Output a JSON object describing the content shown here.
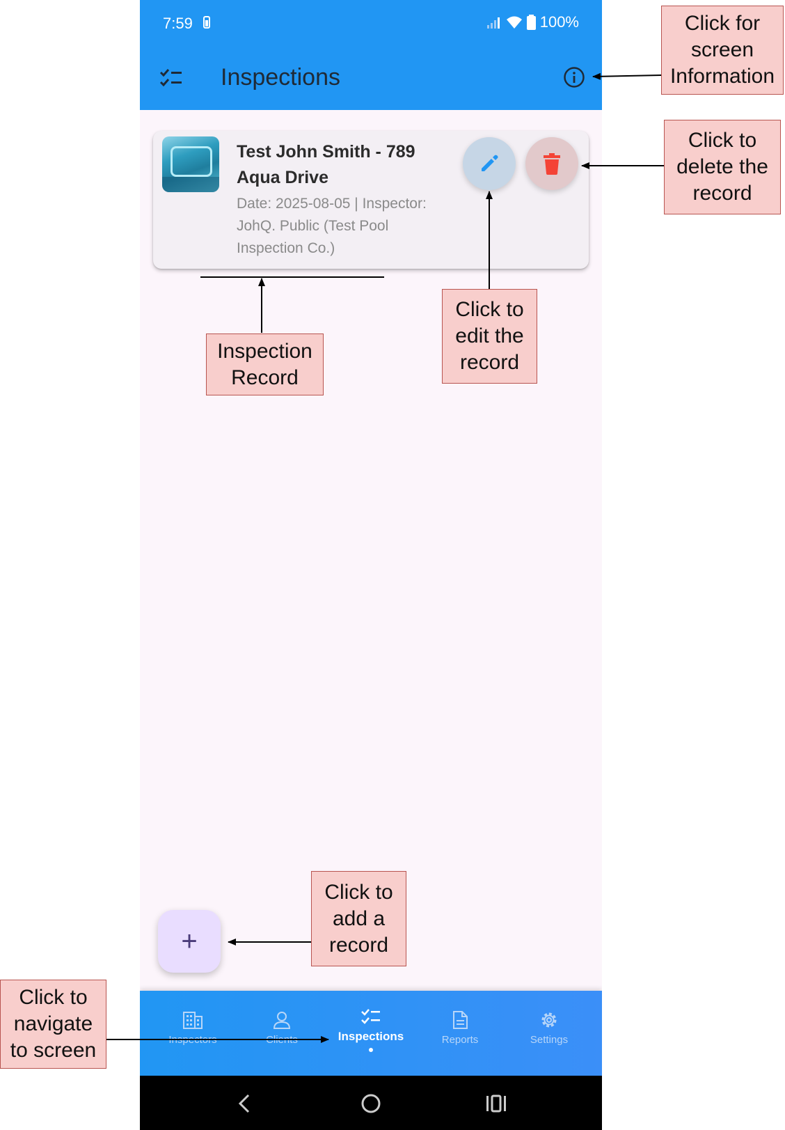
{
  "status_bar": {
    "time": "7:59",
    "battery": "100%"
  },
  "app_bar": {
    "title": "Inspections"
  },
  "record": {
    "title": "Test John Smith - 789 Aqua Drive",
    "subtitle": "Date: 2025-08-05 | Inspector: JohQ. Public (Test Pool Inspection Co.)"
  },
  "fab": {
    "label": "+"
  },
  "bottom_nav": {
    "items": [
      {
        "label": "Inspectors",
        "icon": "building-icon"
      },
      {
        "label": "Clients",
        "icon": "person-icon"
      },
      {
        "label": "Inspections",
        "icon": "checklist-icon",
        "active": true
      },
      {
        "label": "Reports",
        "icon": "document-icon"
      },
      {
        "label": "Settings",
        "icon": "gear-icon"
      }
    ]
  },
  "callouts": {
    "info": "Click for\nscreen\nInformation",
    "delete": "Click to\ndelete the\nrecord",
    "edit": "Click to\nedit the\nrecord",
    "record": "Inspection\nRecord",
    "add": "Click to\nadd a\nrecord",
    "navigate": "Click to\nnavigate\nto screen"
  },
  "colors": {
    "app_bar": "#2196f3",
    "background": "#fcf5fb",
    "delete_icon": "#f44336",
    "edit_icon": "#2196f3",
    "fab": "#e9ddff",
    "callout_fill": "#f8cecc"
  }
}
